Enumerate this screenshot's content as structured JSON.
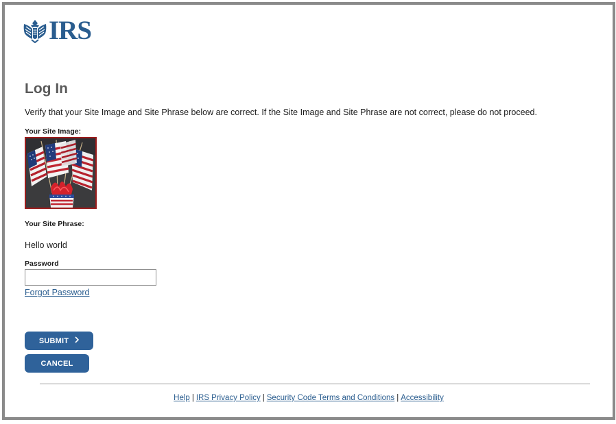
{
  "brand": {
    "name": "IRS",
    "logo_icon": "eagle-logo-icon"
  },
  "page": {
    "title": "Log In",
    "intro": "Verify that your Site Image and Site Phrase below are correct. If the Site Image and Site Phrase are not correct, please do not proceed."
  },
  "site_image": {
    "label": "Your Site Image:"
  },
  "site_phrase": {
    "label": "Your Site Phrase:",
    "value": "Hello world"
  },
  "password": {
    "label": "Password",
    "value": "",
    "placeholder": ""
  },
  "forgot_password": "Forgot Password",
  "buttons": {
    "submit": "SUBMIT",
    "cancel": "CANCEL"
  },
  "footer": {
    "links": [
      "Help",
      "IRS Privacy Policy",
      "Security Code Terms and Conditions",
      "Accessibility"
    ]
  },
  "colors": {
    "brand_blue": "#2a5d8f",
    "button_blue": "#2f629a",
    "image_border": "#9b1c1c",
    "frame_gray": "#8a8a8a"
  }
}
